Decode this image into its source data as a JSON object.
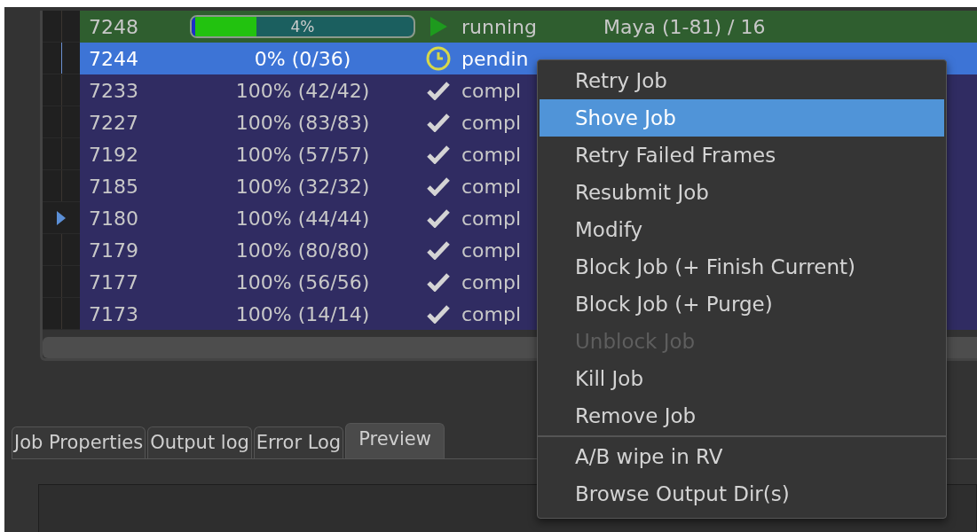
{
  "jobs": [
    {
      "kind": "running",
      "id": "7248",
      "progress": "4%",
      "level": 0.29,
      "status": "running",
      "layer": "Maya  (1-81) / 16",
      "selected": false,
      "current": false
    },
    {
      "kind": "pending",
      "id": "7244",
      "progress": "0% (0/36)",
      "status": "pendin",
      "selected": true,
      "current": false
    },
    {
      "kind": "done",
      "id": "7233",
      "progress": "100% (42/42)",
      "status": "compl",
      "selected": false,
      "current": false
    },
    {
      "kind": "done",
      "id": "7227",
      "progress": "100% (83/83)",
      "status": "compl",
      "selected": false,
      "current": false
    },
    {
      "kind": "done",
      "id": "7192",
      "progress": "100% (57/57)",
      "status": "compl",
      "selected": false,
      "current": false
    },
    {
      "kind": "done",
      "id": "7185",
      "progress": "100% (32/32)",
      "status": "compl",
      "selected": false,
      "current": false
    },
    {
      "kind": "done",
      "id": "7180",
      "progress": "100% (44/44)",
      "status": "compl",
      "selected": false,
      "current": true
    },
    {
      "kind": "done",
      "id": "7179",
      "progress": "100% (80/80)",
      "status": "compl",
      "selected": false,
      "current": false
    },
    {
      "kind": "done",
      "id": "7177",
      "progress": "100% (56/56)",
      "status": "compl",
      "selected": false,
      "current": false
    },
    {
      "kind": "done",
      "id": "7173",
      "progress": "100% (14/14)",
      "status": "compl",
      "selected": false,
      "current": false
    }
  ],
  "tabs": [
    {
      "label": "Job Properties",
      "selected": false
    },
    {
      "label": "Output log",
      "selected": false
    },
    {
      "label": "Error Log",
      "selected": false
    },
    {
      "label": "Preview",
      "selected": true
    }
  ],
  "context_menu": [
    {
      "kind": "item",
      "label": "Retry Job",
      "selected": false,
      "disabled": false
    },
    {
      "kind": "item",
      "label": "Shove Job",
      "selected": true,
      "disabled": false
    },
    {
      "kind": "item",
      "label": "Retry Failed Frames",
      "selected": false,
      "disabled": false
    },
    {
      "kind": "item",
      "label": "Resubmit Job",
      "selected": false,
      "disabled": false
    },
    {
      "kind": "item",
      "label": "Modify",
      "selected": false,
      "disabled": false
    },
    {
      "kind": "item",
      "label": "Block Job (+ Finish Current)",
      "selected": false,
      "disabled": false
    },
    {
      "kind": "item",
      "label": "Block Job (+ Purge)",
      "selected": false,
      "disabled": false
    },
    {
      "kind": "item",
      "label": "Unblock Job",
      "selected": false,
      "disabled": true
    },
    {
      "kind": "item",
      "label": "Kill Job",
      "selected": false,
      "disabled": false
    },
    {
      "kind": "item",
      "label": "Remove Job",
      "selected": false,
      "disabled": false
    },
    {
      "kind": "separator"
    },
    {
      "kind": "item",
      "label": "A/B wipe in RV",
      "selected": false,
      "disabled": false
    },
    {
      "kind": "item",
      "label": "Browse Output Dir(s)",
      "selected": false,
      "disabled": false
    }
  ]
}
